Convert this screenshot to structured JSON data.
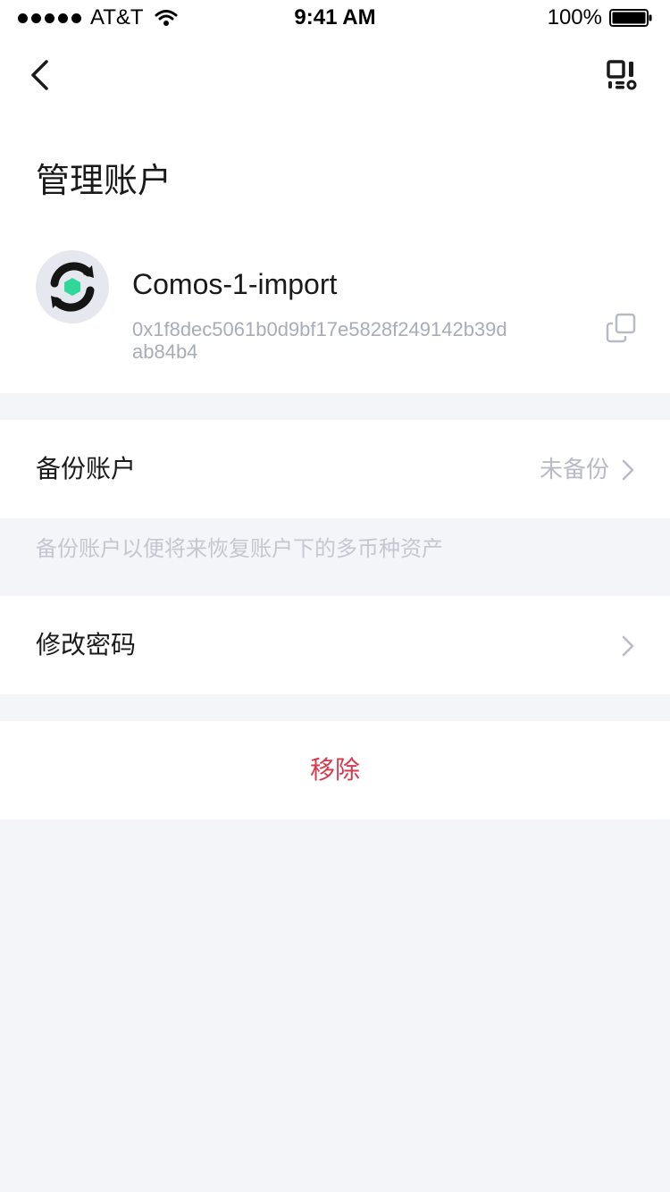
{
  "status_bar": {
    "carrier": "AT&T",
    "time": "9:41 AM",
    "battery": "100%"
  },
  "header": {
    "title": "管理账户"
  },
  "account": {
    "name": "Comos-1-import",
    "address": "0x1f8dec5061b0d9bf17e5828f249142b39dab84b4",
    "logo_accent": "#2fd79b"
  },
  "rows": {
    "backup": {
      "label": "备份账户",
      "value": "未备份"
    },
    "backup_hint": "备份账户以便将来恢复账户下的多币种资产",
    "change_password": {
      "label": "修改密码"
    },
    "remove": {
      "label": "移除",
      "color": "#d6394b"
    }
  },
  "icons": {
    "back": "chevron-left-icon",
    "scan": "qr-scan-icon",
    "copy": "copy-icon",
    "chevron": "chevron-right-icon"
  }
}
